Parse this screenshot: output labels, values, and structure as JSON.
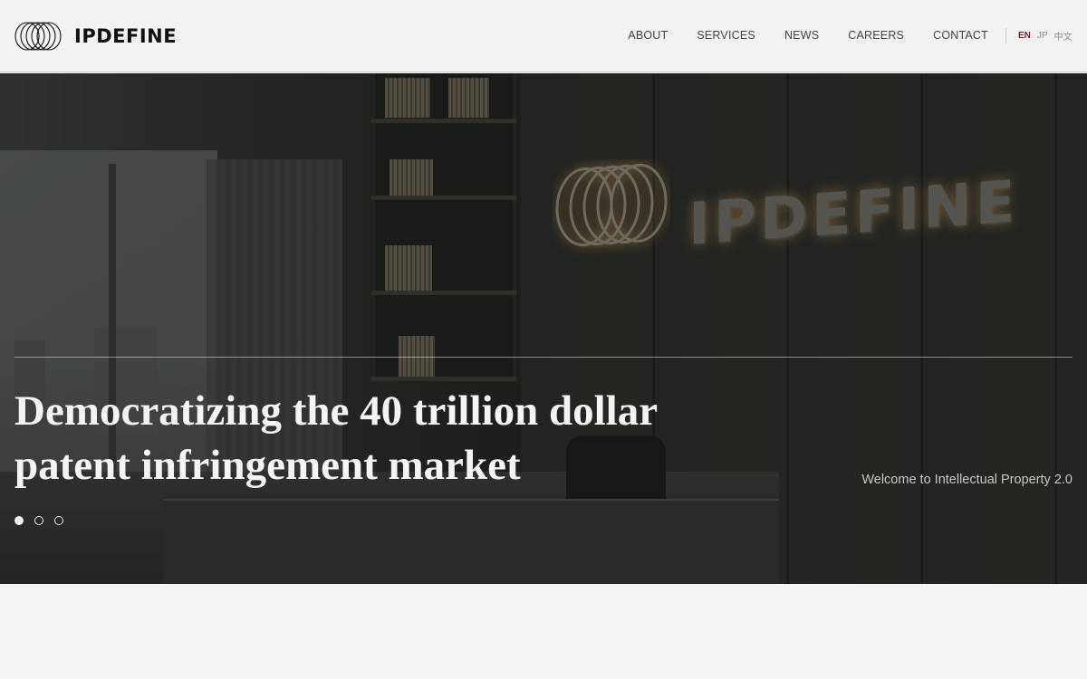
{
  "brand": {
    "name": "IPDEFINE",
    "logo_icon": "interlocking-rings-logo"
  },
  "nav": {
    "items": [
      {
        "label": "ABOUT"
      },
      {
        "label": "SERVICES"
      },
      {
        "label": "NEWS"
      },
      {
        "label": "CAREERS"
      },
      {
        "label": "CONTACT"
      }
    ]
  },
  "languages": {
    "items": [
      {
        "label": "EN",
        "active": true
      },
      {
        "label": "JP",
        "active": false
      },
      {
        "label": "中文",
        "active": false
      }
    ],
    "active_color": "#7a2033"
  },
  "hero": {
    "title_line1": "Democratizing the 40 trillion dollar",
    "title_line2": "patent infringement market",
    "tagline": "Welcome to Intellectual Property 2.0",
    "wall_sign": "IPDEFINE",
    "slides": {
      "count": 3,
      "active_index": 0
    }
  },
  "colors": {
    "header_bg": "#f2f2f1",
    "page_bg": "#f5f5f3",
    "hero_text": "#f4f4f2"
  }
}
